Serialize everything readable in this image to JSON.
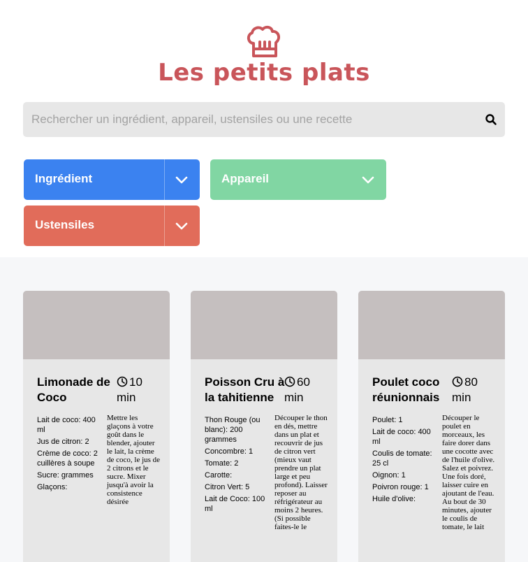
{
  "brand": {
    "title": "Les petits plats",
    "color": "#c9555a",
    "logo_icon": "chef-hat-icon"
  },
  "search": {
    "placeholder": "Rechercher un ingrédient, appareil, ustensiles ou une recette",
    "value": "",
    "icon": "search-icon"
  },
  "filters": [
    {
      "label": "Ingrédient",
      "color": "#3b82f0"
    },
    {
      "label": "Appareil",
      "color": "#81d6a3"
    },
    {
      "label": "Ustensiles",
      "color": "#e16c5a"
    }
  ],
  "recipes": [
    {
      "name": "Limonade de Coco",
      "time": "10",
      "unit": "min",
      "ingredients": [
        {
          "name": "Lait de coco:",
          "qty": "400 ml"
        },
        {
          "name": "Jus de citron:",
          "qty": "2"
        },
        {
          "name": "Crème de coco:",
          "qty": "2 cuillères à soupe"
        },
        {
          "name": "Sucre:",
          "qty": "grammes"
        },
        {
          "name": "Glaçons:",
          "qty": ""
        }
      ],
      "description": "Mettre les glaçons à votre goût dans le blender, ajouter le lait, la crème de coco, le jus de 2 citrons et le sucre. Mixer jusqu'à avoir la consistence désirée"
    },
    {
      "name": "Poisson Cru à la tahitienne",
      "time": "60",
      "unit": "min",
      "ingredients": [
        {
          "name": "Thon Rouge (ou blanc):",
          "qty": "200 grammes"
        },
        {
          "name": "Concombre:",
          "qty": "1"
        },
        {
          "name": "Tomate:",
          "qty": "2"
        },
        {
          "name": "Carotte:",
          "qty": ""
        },
        {
          "name": "Citron Vert:",
          "qty": "5"
        },
        {
          "name": "Lait de Coco:",
          "qty": "100 ml"
        }
      ],
      "description": "Découper le thon en dés, mettre dans un plat et recouvrir de jus de citron vert (mieux vaut prendre un plat large et peu profond). Laisser reposer au réfrigérateur au moins 2 heures. (Si possible faites-le le"
    },
    {
      "name": "Poulet coco réunionnais",
      "time": "80",
      "unit": "min",
      "ingredients": [
        {
          "name": "Poulet:",
          "qty": "1"
        },
        {
          "name": "Lait de coco:",
          "qty": "400 ml"
        },
        {
          "name": "Coulis de tomate:",
          "qty": "25 cl"
        },
        {
          "name": "Oignon:",
          "qty": "1"
        },
        {
          "name": "Poivron rouge:",
          "qty": "1"
        },
        {
          "name": "Huile d'olive:",
          "qty": ""
        }
      ],
      "description": "Découper le poulet en morceaux, les faire dorer dans une cocotte avec de l'huile d'olive. Salez et poivrez. Une fois doré, laisser cuire en ajoutant de l'eau. Au bout de 30 minutes, ajouter le coulis de tomate, le lait"
    }
  ]
}
